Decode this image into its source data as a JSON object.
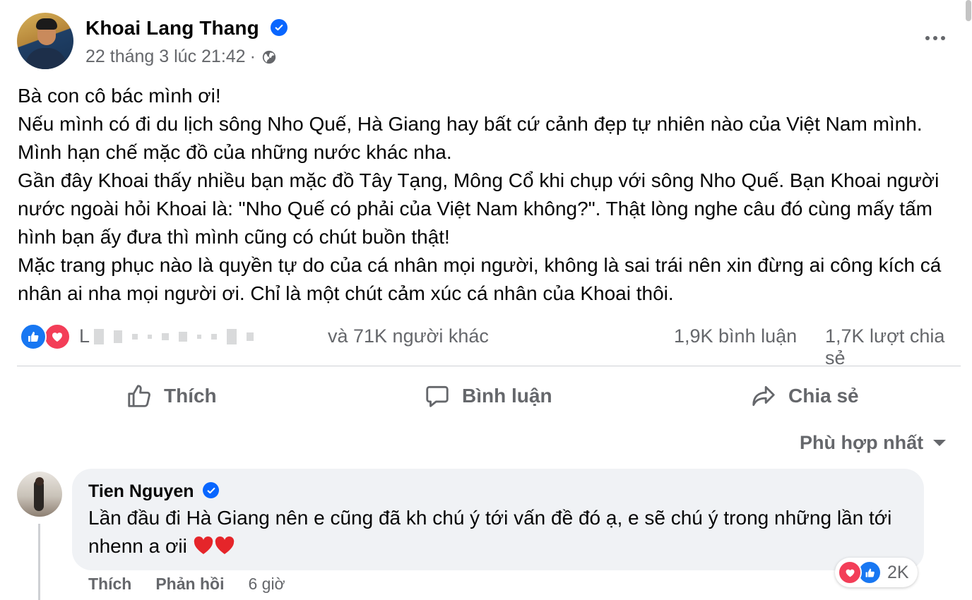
{
  "post": {
    "author": "Khoai Lang Thang",
    "timestamp": "22 tháng 3 lúc 21:42",
    "separator": "·",
    "privacy_icon": "globe-icon",
    "verified_icon": "verified-badge-icon",
    "text_lines": [
      "Bà con cô bác mình ơi!",
      "Nếu mình có đi du lịch sông Nho Quế, Hà Giang hay bất cứ cảnh đẹp tự nhiên nào của Việt Nam mình. Mình hạn chế mặc đồ của những nước khác nha.",
      "Gần đây Khoai thấy nhiều bạn mặc đồ Tây Tạng, Mông Cổ khi chụp với sông Nho Quế. Bạn Khoai người nước ngoài hỏi Khoai là: \"Nho Quế có phải của Việt Nam không?\". Thật lòng nghe câu đó cùng mấy tấm hình bạn ấy đưa thì mình cũng có chút buồn thật!",
      "Mặc trang phục nào là quyền tự do của cá nhân mọi người, không là sai trái nên xin đừng ai công kích cá nhân ai nha mọi người ơi. Chỉ là một chút cảm xúc cá nhân của Khoai thôi."
    ]
  },
  "stats": {
    "names_prefix": "L",
    "reactions_text": "và 71K người khác",
    "comments": "1,9K bình luận",
    "shares": "1,7K lượt chia sẻ"
  },
  "actions": {
    "like": "Thích",
    "comment": "Bình luận",
    "share": "Chia sẻ"
  },
  "sort": {
    "label": "Phù hợp nhất"
  },
  "comment": {
    "author": "Tien Nguyen",
    "text": "Lần đầu đi Hà Giang nên e cũng đã kh chú ý tới vấn đề đó ạ, e sẽ chú ý trong những lần tới nhenn a ơii",
    "reaction_count": "2K",
    "like_label": "Thích",
    "reply_label": "Phản hồi",
    "time": "6 giờ"
  },
  "colors": {
    "primary_text": "#050505",
    "secondary_text": "#65676b",
    "accent_blue": "#0866ff",
    "like_blue": "#1877f2",
    "love_red": "#f33e58",
    "bubble_bg": "#f0f2f5"
  }
}
